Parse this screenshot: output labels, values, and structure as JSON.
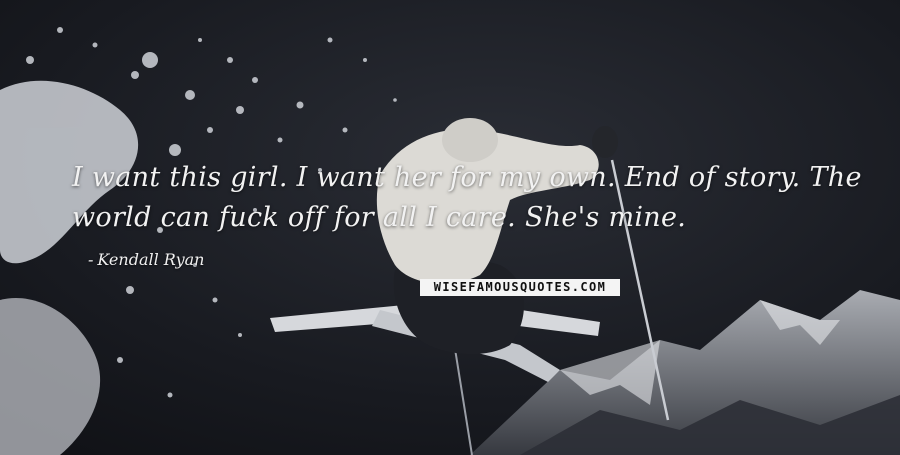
{
  "quote": {
    "text": "I want this girl. I want her for my own. End of story. The world can fuck off for all I care. She's mine.",
    "author": "Kendall Ryan"
  },
  "watermark": {
    "text": "WISEFAMOUSQUOTES.COM"
  },
  "background": {
    "description_icon": "skier-background-image",
    "sky_color": "#14161c",
    "accent_color": "#f2f2f2"
  }
}
